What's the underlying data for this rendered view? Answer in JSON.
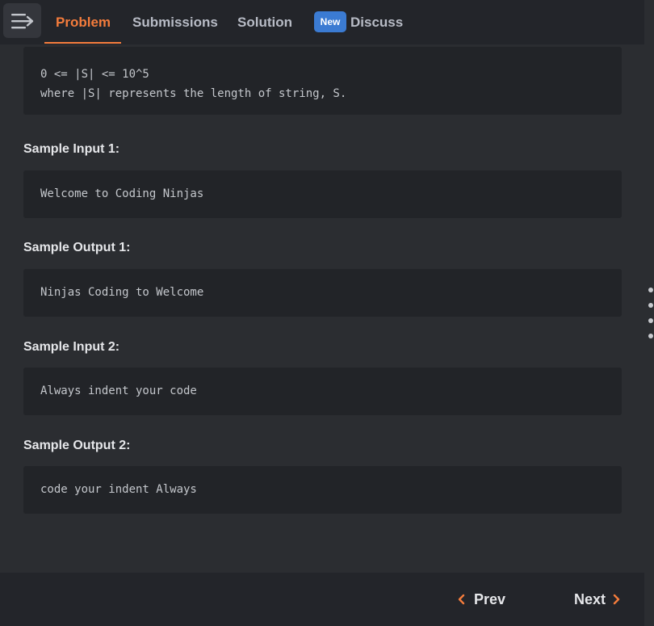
{
  "tabs": [
    {
      "label": "Problem",
      "active": true
    },
    {
      "label": "Submissions",
      "active": false
    },
    {
      "label": "Solution",
      "active": false
    },
    {
      "label": "Discuss",
      "active": false,
      "badge": "New"
    }
  ],
  "content": {
    "constraints_lines": [
      "0 <= |S| <= 10^5",
      "where |S| represents the length of string, S."
    ],
    "samples": [
      {
        "heading": "Sample Input 1:",
        "text": "Welcome to Coding Ninjas"
      },
      {
        "heading": "Sample Output 1:",
        "text": "Ninjas Coding to Welcome"
      },
      {
        "heading": "Sample Input 2:",
        "text": "Always indent your code"
      },
      {
        "heading": "Sample Output 2:",
        "text": "code your indent Always"
      }
    ]
  },
  "footer": {
    "prev_label": "Prev",
    "next_label": "Next",
    "prev_icon": "chevron-left-icon",
    "next_icon": "chevron-right-icon"
  },
  "icons": {
    "menu": "menu-collapse-icon"
  },
  "colors": {
    "accent": "#f47c3c",
    "badge": "#3b7bd2",
    "background": "#2b2d31",
    "bar": "#23252a",
    "code_bg": "#222428"
  }
}
